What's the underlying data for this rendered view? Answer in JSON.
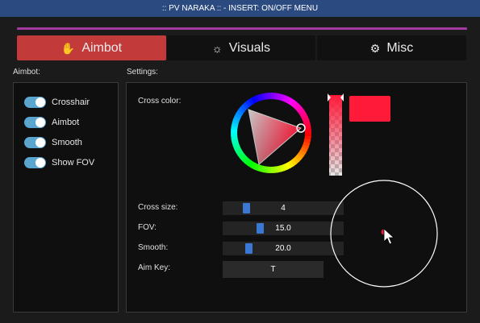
{
  "window": {
    "title": ":: PV NARAKA :: - INSERT: ON/OFF MENU"
  },
  "tabs": [
    {
      "label": "Aimbot",
      "icon": "hand-icon",
      "active": true
    },
    {
      "label": "Visuals",
      "icon": "sun-icon",
      "active": false
    },
    {
      "label": "Misc",
      "icon": "gears-icon",
      "active": false
    }
  ],
  "aimbot_panel": {
    "heading": "Aimbot:",
    "toggles": [
      {
        "label": "Crosshair",
        "on": true
      },
      {
        "label": "Aimbot",
        "on": true
      },
      {
        "label": "Smooth",
        "on": true
      },
      {
        "label": "Show FOV",
        "on": true
      }
    ]
  },
  "settings_panel": {
    "heading": "Settings:",
    "cross_color_label": "Cross color:",
    "cross_color": "#ff1a3a",
    "cross_size": {
      "label": "Cross size:",
      "value": "4",
      "fraction": 0.18
    },
    "fov": {
      "label": "FOV:",
      "value": "15.0",
      "fraction": 0.3
    },
    "smooth": {
      "label": "Smooth:",
      "value": "20.0",
      "fraction": 0.2
    },
    "aim_key": {
      "label": "Aim Key:",
      "value": "T"
    }
  },
  "colors": {
    "titlebar": "#2b4a80",
    "accent_line": "#a23aa0",
    "active_tab": "#c23a3a",
    "toggle_on": "#5aa6cf",
    "slider_grab": "#3a78d4",
    "fov_dot": "#e0203a"
  }
}
